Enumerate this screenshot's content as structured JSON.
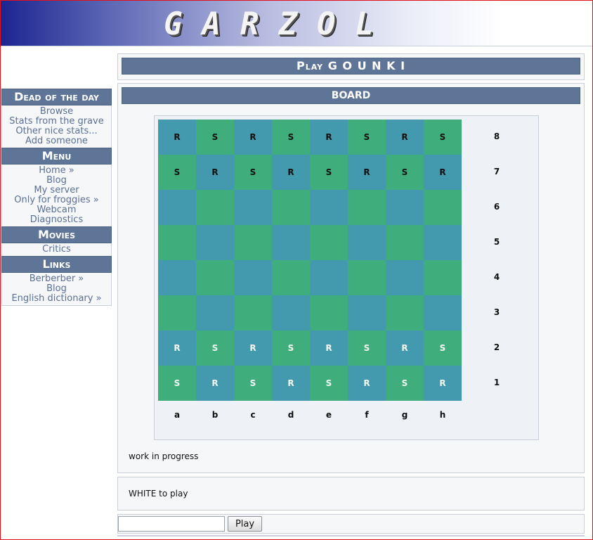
{
  "header": {
    "logo_text": "GARZOL"
  },
  "sidebar": {
    "sections": [
      {
        "title": "Dead of the day",
        "links": [
          "Browse",
          "Stats from the grave",
          "Other nice stats...",
          "Add someone"
        ]
      },
      {
        "title": "Menu",
        "links": [
          "Home »",
          "Blog",
          "My server",
          "Only for froggies »",
          "Webcam",
          "Diagnostics"
        ]
      },
      {
        "title": "Movies",
        "links": [
          "Critics"
        ]
      },
      {
        "title": "Links",
        "links": [
          "Berberber »",
          "Blog",
          "English dictionary »"
        ]
      }
    ]
  },
  "main": {
    "title": "Play G O U N K I",
    "board_title": "BOARD",
    "status": "work in progress",
    "turn": "WHITE to play",
    "play_label": "Play",
    "move_value": ""
  },
  "board": {
    "files": [
      "a",
      "b",
      "c",
      "d",
      "e",
      "f",
      "g",
      "h"
    ],
    "ranks": [
      "8",
      "7",
      "6",
      "5",
      "4",
      "3",
      "2",
      "1"
    ],
    "rows": [
      [
        "R",
        "S",
        "R",
        "S",
        "R",
        "S",
        "R",
        "S"
      ],
      [
        "S",
        "R",
        "S",
        "R",
        "S",
        "R",
        "S",
        "R"
      ],
      [
        "",
        "",
        "",
        "",
        "",
        "",
        "",
        ""
      ],
      [
        "",
        "",
        "",
        "",
        "",
        "",
        "",
        ""
      ],
      [
        "",
        "",
        "",
        "",
        "",
        "",
        "",
        ""
      ],
      [
        "",
        "",
        "",
        "",
        "",
        "",
        "",
        ""
      ],
      [
        "R",
        "S",
        "R",
        "S",
        "R",
        "S",
        "R",
        "S"
      ],
      [
        "S",
        "R",
        "S",
        "R",
        "S",
        "R",
        "S",
        "R"
      ]
    ],
    "white_piece_ranks": [
      "2",
      "1"
    ],
    "colors": {
      "square_blue": "#4399ae",
      "square_green": "#40ae7c",
      "header_bar": "#5f7597",
      "frame": "#e3111c"
    }
  }
}
